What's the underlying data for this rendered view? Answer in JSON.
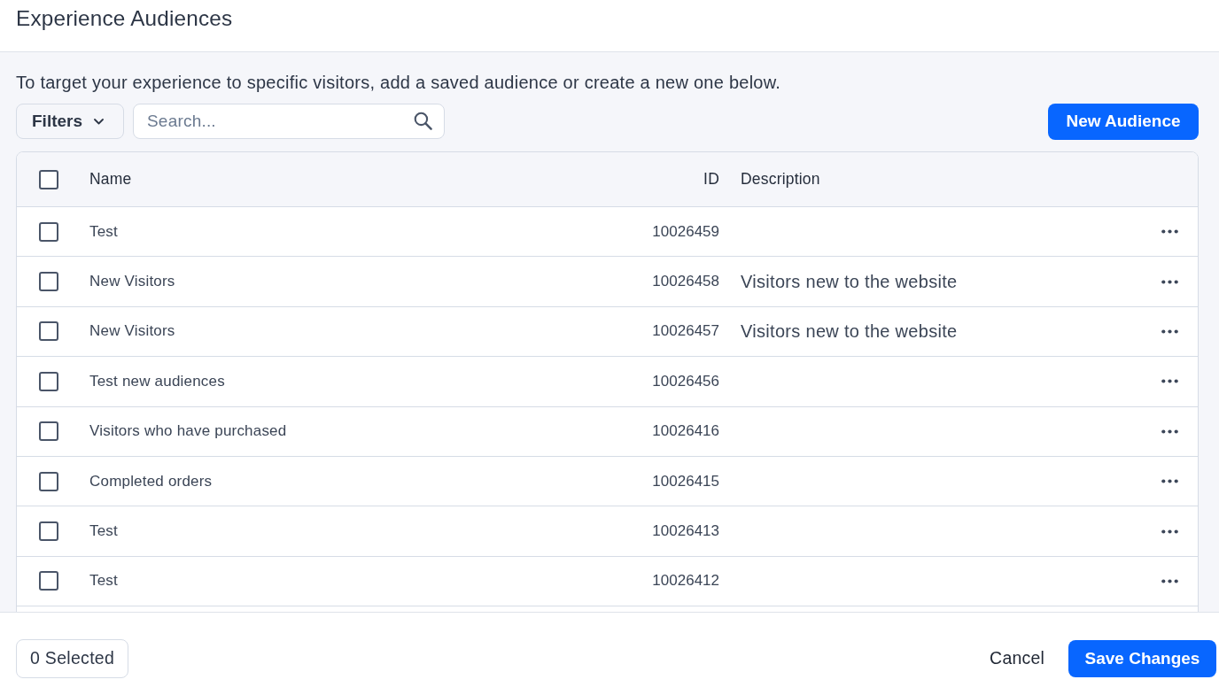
{
  "header": {
    "title": "Experience Audiences"
  },
  "intro": "To target your experience to specific visitors, add a saved audience or create a new one below.",
  "toolbar": {
    "filters_button": "Filters",
    "search": {
      "placeholder": "Search..."
    },
    "new_audience_button": "New Audience"
  },
  "table": {
    "select_all": {
      "checked": false
    },
    "columns": [
      "Name",
      "ID",
      "Description"
    ],
    "rows": [
      {
        "checked": false,
        "name": "Test",
        "id": "10026459"
      },
      {
        "checked": false,
        "name": "New Visitors",
        "id": "10026458",
        "description": "Visitors new to the website"
      },
      {
        "checked": false,
        "name": "New Visitors",
        "id": "10026457",
        "description": "Visitors new to the website"
      },
      {
        "checked": false,
        "name": "Test new audiences",
        "id": "10026456"
      },
      {
        "checked": false,
        "name": "Visitors who have purchased",
        "id": "10026416"
      },
      {
        "checked": false,
        "name": "Completed orders",
        "id": "10026415"
      },
      {
        "checked": false,
        "name": "Test",
        "id": "10026413"
      },
      {
        "checked": false,
        "name": "Test",
        "id": "10026412"
      }
    ]
  },
  "footer": {
    "selected_count": "0 Selected",
    "cancel_button": "Cancel",
    "save_button": "Save Changes"
  }
}
